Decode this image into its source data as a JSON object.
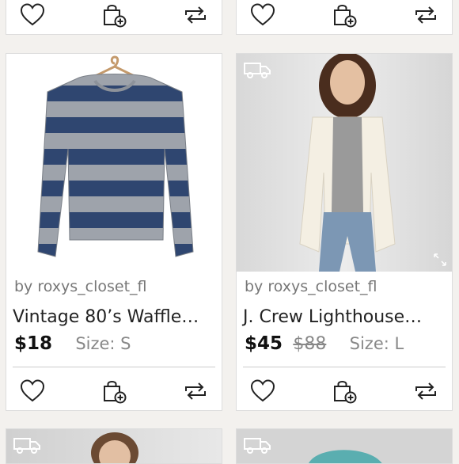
{
  "listings": [
    {
      "seller": "by roxys_closet_fl",
      "title": "Vintage 80’s Waffle…",
      "price": "$18",
      "original_price": "",
      "size": "Size: S",
      "image_icon": "striped-sweater-photo",
      "ships_free": false
    },
    {
      "seller": "by roxys_closet_fl",
      "title": "J. Crew Lighthouse…",
      "price": "$45",
      "original_price": "$88",
      "size": "Size: L",
      "image_icon": "cream-cardigan-photo",
      "ships_free": true
    }
  ],
  "actions": {
    "like_icon": "heart-icon",
    "bundle_icon": "bag-plus-icon",
    "share_icon": "share-arrows-icon"
  },
  "colors": {
    "background": "#f3f1ee",
    "price": "#111111",
    "muted": "#888888"
  }
}
